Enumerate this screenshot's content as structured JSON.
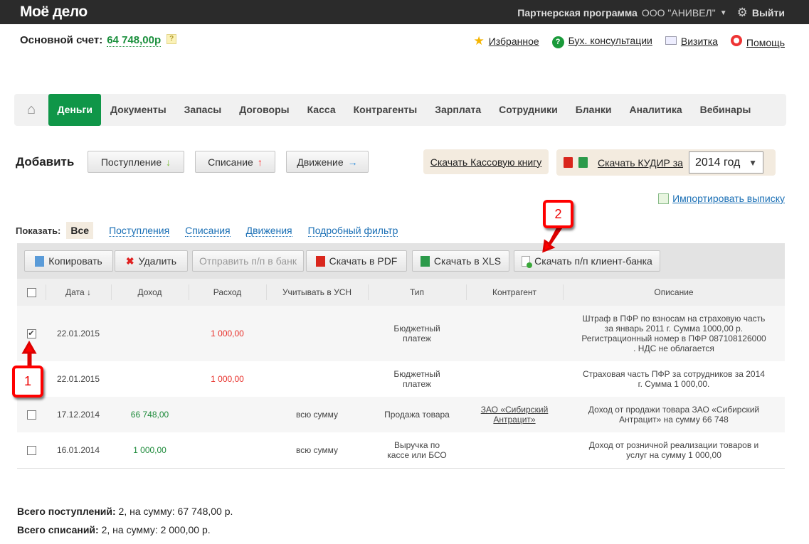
{
  "header": {
    "logo": "Moё дело",
    "partner": "Партнерская программа",
    "company": "ООО \"АНИВЕЛ\"",
    "logout": "Выйти"
  },
  "account": {
    "label": "Основной счет:",
    "sum": "64 748,00р",
    "help": "?"
  },
  "toplinks": [
    {
      "label": "Избранное",
      "icon": "star-icon"
    },
    {
      "label": "Бух. консультации",
      "icon": "chat-question-icon"
    },
    {
      "label": "Визитка",
      "icon": "card-icon"
    },
    {
      "label": "Помощь",
      "icon": "lifebuoy-icon"
    }
  ],
  "nav": [
    "Деньги",
    "Документы",
    "Запасы",
    "Договоры",
    "Касса",
    "Контрагенты",
    "Зарплата",
    "Сотрудники",
    "Бланки",
    "Аналитика",
    "Вебинары"
  ],
  "add": {
    "label": "Добавить",
    "buttons": [
      {
        "label": "Поступление",
        "arrow": "↓"
      },
      {
        "label": "Списание",
        "arrow": "↑"
      },
      {
        "label": "Движение",
        "arrow": "→"
      }
    ]
  },
  "downloads": {
    "cashbook": "Скачать Кассовую книгу",
    "kudir": "Скачать КУДИР за",
    "year": "2014 год",
    "import": "Импортировать выписку"
  },
  "filter": {
    "label": "Показать:",
    "items": [
      "Все",
      "Поступления",
      "Списания",
      "Движения",
      "Подробный фильтр"
    ]
  },
  "toolbar": [
    "Копировать",
    "Удалить",
    "Отправить п/п в банк",
    "Скачать в PDF",
    "Скачать в XLS",
    "Скачать п/п клиент-банка"
  ],
  "table": {
    "columns": [
      "Дата ↓",
      "Доход",
      "Расход",
      "Учитывать в УСН",
      "Тип",
      "Контрагент",
      "Описание"
    ],
    "rows": [
      {
        "checked": true,
        "date": "22.01.2015",
        "income": "",
        "expense": "1 000,00",
        "usn": "",
        "type": "Бюджетный платеж",
        "contractor": "",
        "desc": "Штраф в ПФР по взносам на страховую часть за январь 2011 г. Сумма 1000,00 р. Регистрационный номер в ПФР 087108126000 . НДС не облагается"
      },
      {
        "checked": false,
        "date": "22.01.2015",
        "income": "",
        "expense": "1 000,00",
        "usn": "",
        "type": "Бюджетный платеж",
        "contractor": "",
        "desc": "Страховая часть ПФР за сотрудников за 2014 г. Сумма 1 000,00."
      },
      {
        "checked": false,
        "date": "17.12.2014",
        "income": "66 748,00",
        "expense": "",
        "usn": "всю сумму",
        "type": "Продажа товара",
        "contractor": "ЗАО «Сибирский Антрацит»",
        "desc": "Доход от продажи товара ЗАО «Сибирский Антрацит» на сумму 66 748"
      },
      {
        "checked": false,
        "date": "16.01.2014",
        "income": "1 000,00",
        "expense": "",
        "usn": "всю сумму",
        "type": "Выручка по кассе или БСО",
        "contractor": "",
        "desc": "Доход от розничной реализации товаров и услуг на сумму 1 000,00"
      }
    ]
  },
  "totals": {
    "income_label": "Всего поступлений:",
    "income_value": "2, на сумму: 67 748,00 р.",
    "expense_label": "Всего списаний:",
    "expense_value": "2, на сумму: 2 000,00 р."
  },
  "callouts": [
    "1",
    "2"
  ]
}
